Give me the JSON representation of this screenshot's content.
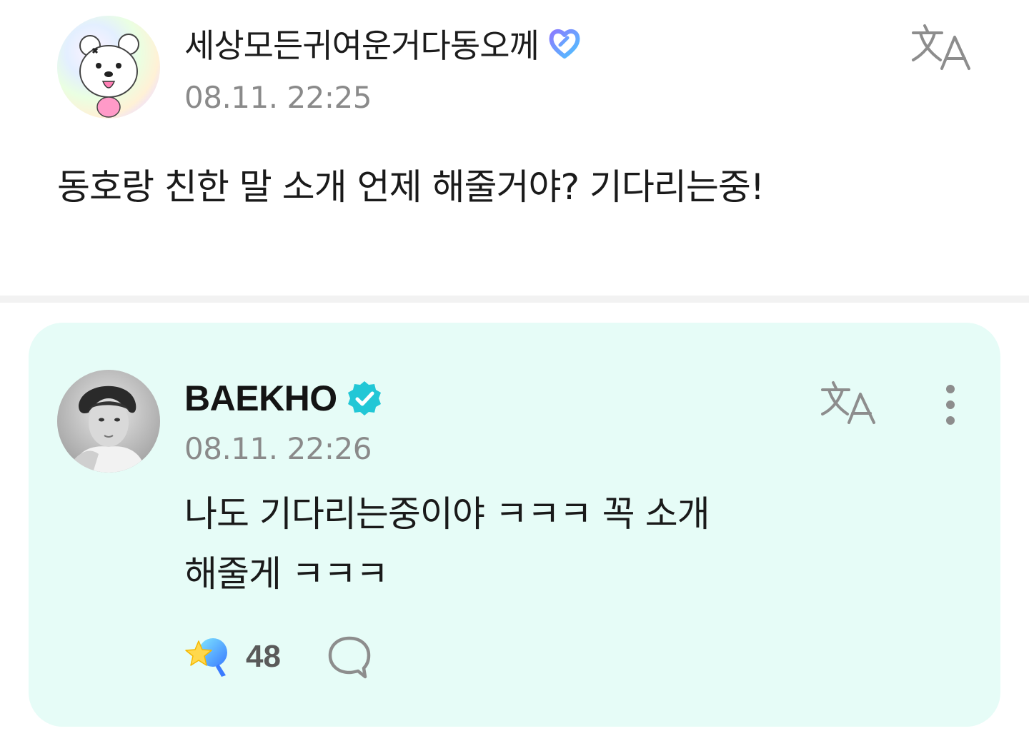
{
  "post": {
    "author_name": "세상모든귀여운거다동오께",
    "timestamp": "08.11. 22:25",
    "body": "동호랑 친한 말 소개 언제 해줄거야? 기다리는중!",
    "icons": {
      "avatar": "bear-avatar",
      "membership": "heart-membership-icon",
      "translate": "translate-icon"
    }
  },
  "reply": {
    "author_name": "BAEKHO",
    "timestamp": "08.11. 22:26",
    "body_lines": [
      "나도 기다리는중이야 ㅋㅋㅋ 꼭 소개",
      "해줄게 ㅋㅋㅋ"
    ],
    "like_count": "48",
    "icons": {
      "avatar": "artist-photo-avatar",
      "verified": "verified-badge-icon",
      "translate": "translate-icon",
      "more": "more-vertical-icon",
      "like": "star-cheer-icon",
      "comment": "comment-bubble-icon"
    }
  },
  "colors": {
    "card_background": "#e6fcf7",
    "verified": "#22c7d6",
    "timestamp": "#8a8a8a",
    "divider": "#f2f2f2"
  }
}
